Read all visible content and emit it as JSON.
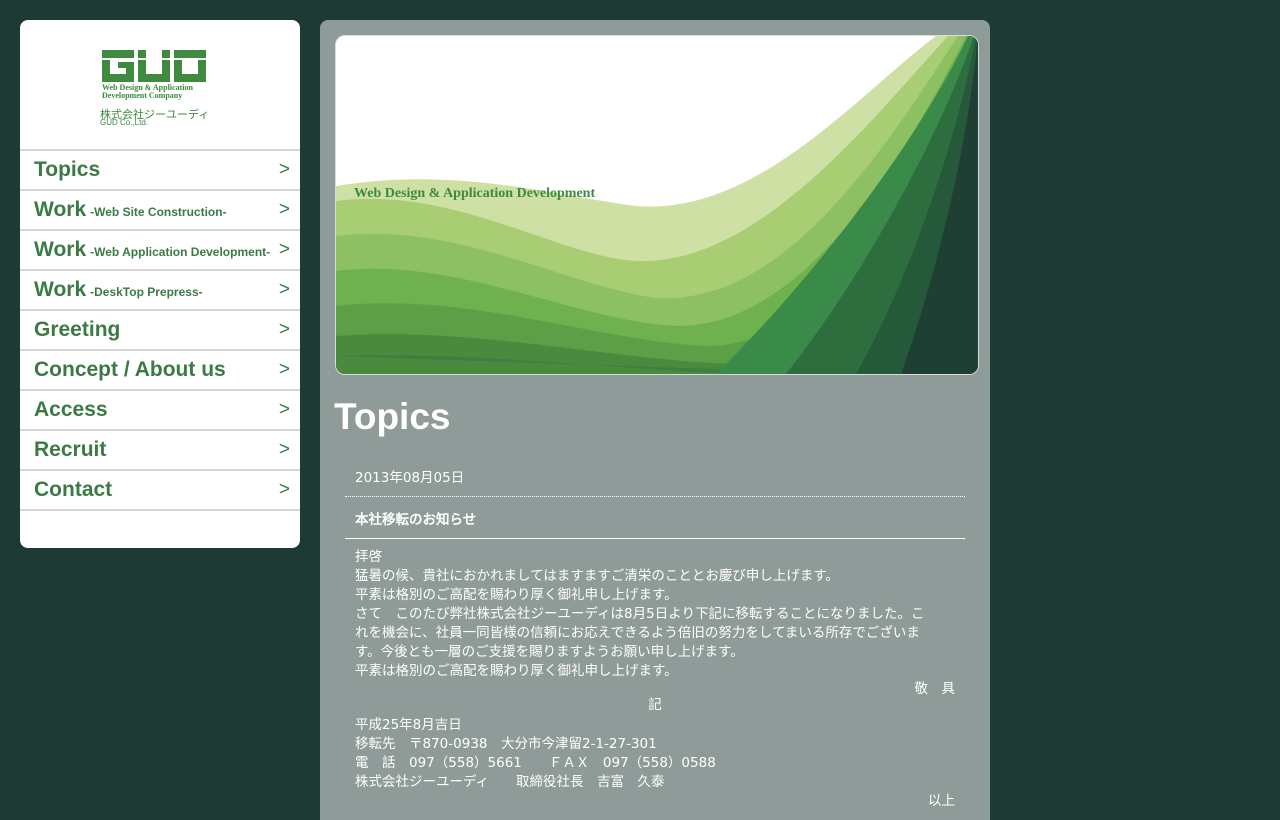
{
  "logo": {
    "mark": "GUD",
    "tagline_line1": "Web Design & Application",
    "tagline_line2": "Development Company",
    "company_jp": "株式会社ジーユーディ",
    "company_en": "GUD Co.,Ltd."
  },
  "nav": {
    "arrow": ">",
    "items": [
      {
        "main": "Topics",
        "sub": ""
      },
      {
        "main": "Work",
        "sub": "-Web Site Construction-"
      },
      {
        "main": "Work",
        "sub": "-Web Application Development-"
      },
      {
        "main": "Work",
        "sub": "-DeskTop Prepress-"
      },
      {
        "main": "Greeting",
        "sub": ""
      },
      {
        "main": "Concept / About us",
        "sub": ""
      },
      {
        "main": "Access",
        "sub": ""
      },
      {
        "main": "Recruit",
        "sub": ""
      },
      {
        "main": "Contact",
        "sub": ""
      }
    ]
  },
  "banner": {
    "text": "Web Design & Application Development"
  },
  "page": {
    "title": "Topics"
  },
  "article": {
    "date": "2013年08月05日",
    "headline": "本社移転のお知らせ",
    "lines": [
      "拝啓",
      "猛暑の候、貴社におかれましてはますますご清栄のこととお慶び申し上げます。",
      "平素は格別のご高配を賜わり厚く御礼申し上げます。",
      "さて　このたび弊社株式会社ジーユーディは8月5日より下記に移転することになりました。こ",
      "れを機会に、社員一同皆様の信頼にお応えできるよう倍旧の努力をしてまいる所存でございま",
      "す。今後とも一層のご支援を賜りますようお願い申し上げます。",
      "平素は格別のご高配を賜わり厚く御礼申し上げます。"
    ],
    "closing": "敬　具",
    "ki": "記",
    "details": [
      "平成25年8月吉日",
      "移転先　〒870-0938　大分市今津留2-1-27-301",
      "電　話　097（558）5661　　ＦＡＸ　097（558）0588",
      "株式会社ジーユーディ　　取締役社長　吉富　久泰"
    ],
    "end": "以上"
  },
  "colors": {
    "page_bg": "#1e3a34",
    "content_bg": "#8e9b98",
    "brand_green": "#3b7a45"
  }
}
